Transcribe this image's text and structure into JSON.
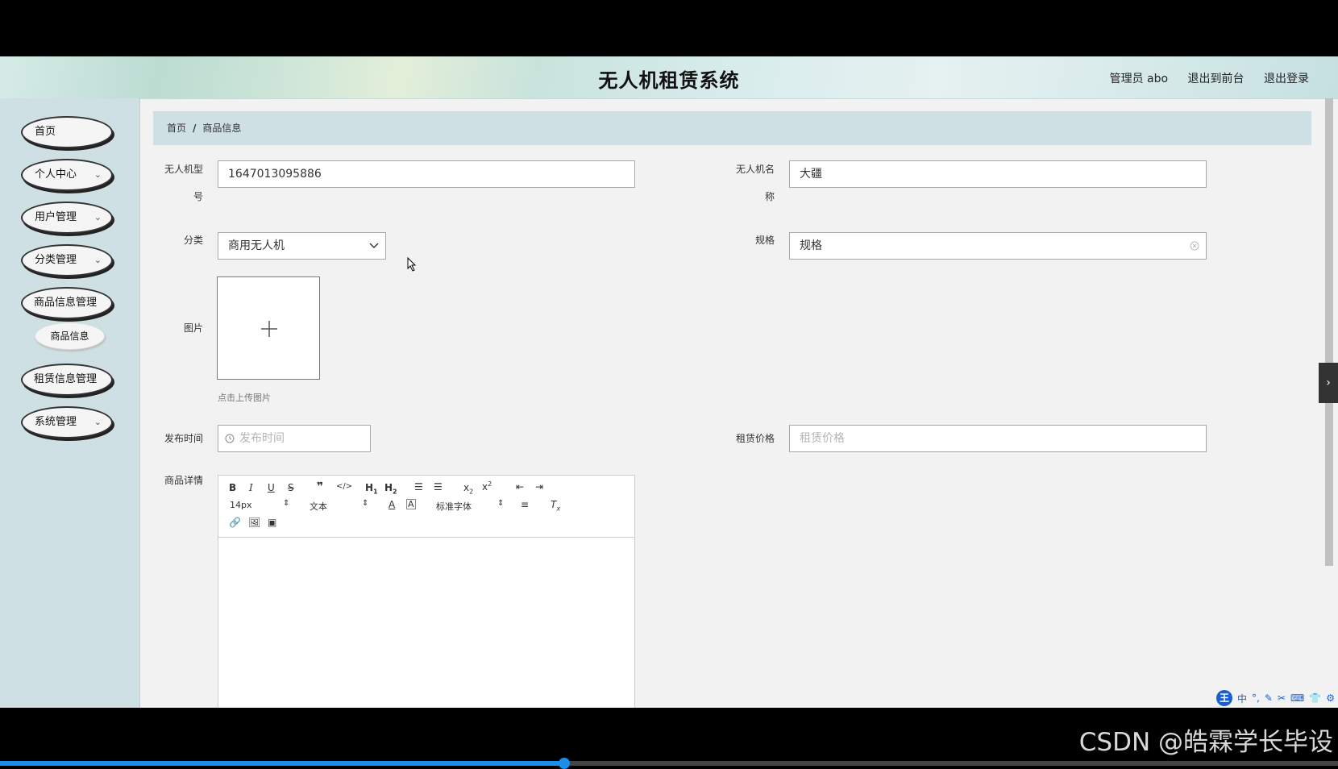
{
  "header": {
    "title": "无人机租赁系统",
    "user": "管理员 abo",
    "to_front": "退出到前台",
    "logout": "退出登录"
  },
  "sidebar": {
    "items": [
      {
        "label": "首页"
      },
      {
        "label": "个人中心"
      },
      {
        "label": "用户管理"
      },
      {
        "label": "分类管理"
      },
      {
        "label": "商品信息管理"
      },
      {
        "label": "租赁信息管理"
      },
      {
        "label": "系统管理"
      }
    ],
    "sub_item": "商品信息",
    "chevron": "⌄"
  },
  "breadcrumb": {
    "home": "首页",
    "sep": "/",
    "current": "商品信息"
  },
  "form": {
    "model_label_1": "无人机型",
    "model_label_2": "号",
    "model_value": "1647013095886",
    "name_label_1": "无人机名",
    "name_label_2": "称",
    "name_value": "大疆",
    "category_label": "分类",
    "category_value": "商用无人机",
    "spec_label": "规格",
    "spec_value": "规格",
    "image_label": "图片",
    "upload_hint": "点击上传图片",
    "publish_label": "发布时间",
    "publish_placeholder": "发布时间",
    "price_label": "租赁价格",
    "price_placeholder": "租赁价格",
    "detail_label": "商品详情"
  },
  "editor": {
    "font_size": "14px",
    "paragraph": "文本",
    "font_family": "标准字体"
  },
  "overlay": {
    "ime": [
      "王",
      "中",
      "°,",
      "✎",
      "✂",
      "⌨",
      "👕",
      "⚙"
    ],
    "watermark": "CSDN @皓霖学长毕设"
  }
}
